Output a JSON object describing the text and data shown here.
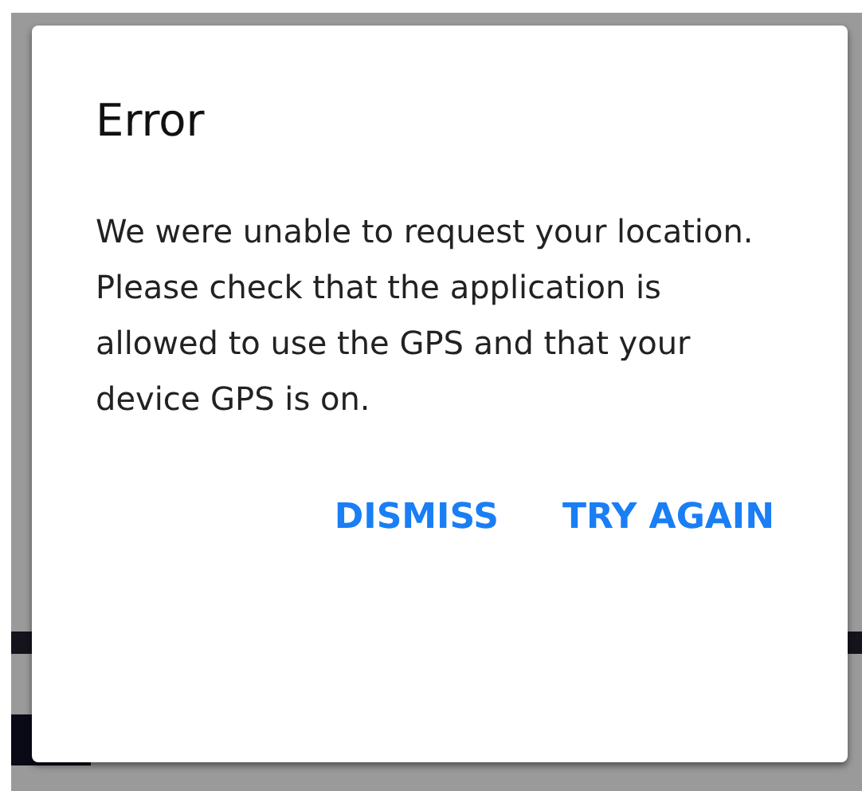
{
  "dialog": {
    "title": "Error",
    "message": [
      "We were unable to request your location.",
      "Please check that the application is allowed to use the GPS and that your device GPS is on."
    ],
    "buttons": [
      {
        "label": "DISMISS"
      },
      {
        "label": "TRY AGAIN"
      }
    ]
  }
}
